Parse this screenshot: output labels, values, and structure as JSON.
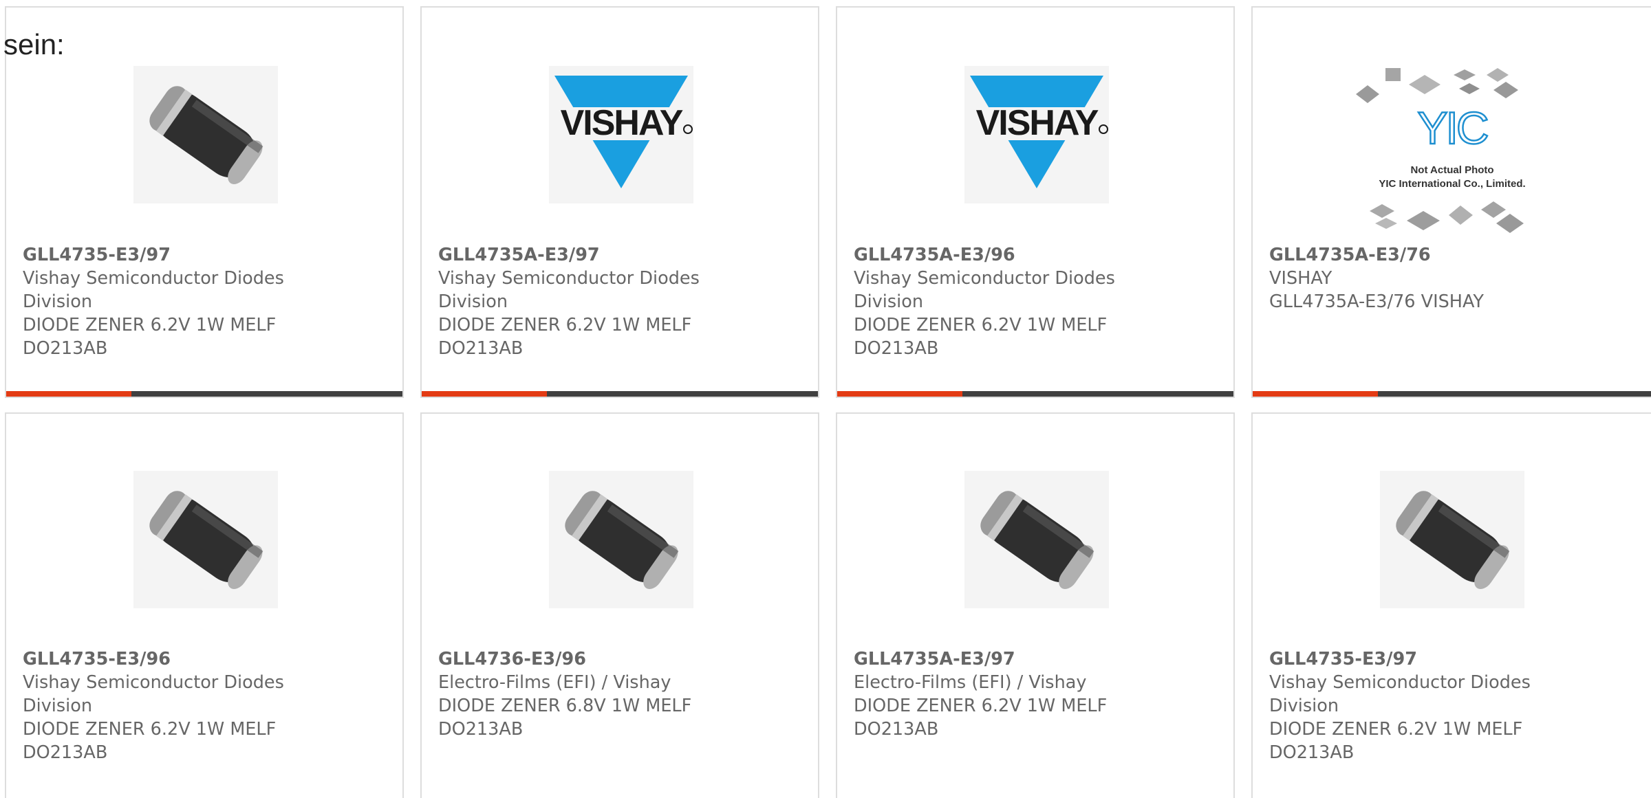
{
  "prefix_text": "sein:",
  "colors": {
    "card_border": "#dddddd",
    "text": "#666666",
    "accent_red": "#e33b14",
    "accent_dark": "#404040",
    "vishay_blue": "#1a9fe0"
  },
  "cards": [
    {
      "part_number": "GLL4735-E3/97",
      "manufacturer": "Vishay Semiconductor Diodes\nDivision",
      "description": "DIODE ZENER 6.2V 1W MELF\nDO213AB",
      "image": "melf-diode-image"
    },
    {
      "part_number": "GLL4735A-E3/97",
      "manufacturer": "Vishay Semiconductor Diodes\nDivision",
      "description": "DIODE ZENER 6.2V 1W MELF\nDO213AB",
      "image": "vishay-logo"
    },
    {
      "part_number": "GLL4735A-E3/96",
      "manufacturer": "Vishay Semiconductor Diodes\nDivision",
      "description": "DIODE ZENER 6.2V 1W MELF\nDO213AB",
      "image": "vishay-logo"
    },
    {
      "part_number": "GLL4735A-E3/76",
      "manufacturer": "VISHAY",
      "description": "GLL4735A-E3/76 VISHAY",
      "image": "yic-placeholder",
      "placeholder": {
        "brand": "YIC",
        "line1": "Not Actual Photo",
        "line2": "YIC International Co., Limited."
      }
    },
    {
      "part_number": "GLL4735-E3/96",
      "manufacturer": "Vishay Semiconductor Diodes\nDivision",
      "description": "DIODE ZENER 6.2V 1W MELF\nDO213AB",
      "image": "melf-diode-image"
    },
    {
      "part_number": "GLL4736-E3/96",
      "manufacturer": "Electro-Films (EFI) / Vishay",
      "description": "DIODE ZENER 6.8V 1W MELF\nDO213AB",
      "image": "melf-diode-image"
    },
    {
      "part_number": "GLL4735A-E3/97",
      "manufacturer": "Electro-Films (EFI) / Vishay",
      "description": "DIODE ZENER 6.2V 1W MELF\nDO213AB",
      "image": "melf-diode-image"
    },
    {
      "part_number": "GLL4735-E3/97",
      "manufacturer": "Vishay Semiconductor Diodes\nDivision",
      "description": "DIODE ZENER 6.2V 1W MELF\nDO213AB",
      "image": "melf-diode-image"
    }
  ]
}
